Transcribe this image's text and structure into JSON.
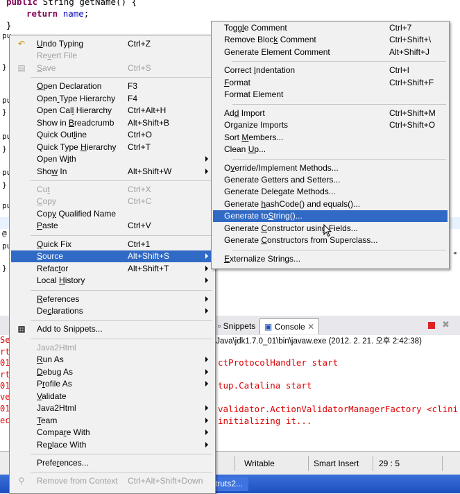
{
  "editor": {
    "line1": {
      "kw": "public",
      "rest": " String getName() {"
    },
    "line2": {
      "kw": "return",
      "field": "name",
      "end": ";"
    },
    "brace": "}",
    "gutter": [
      "pu",
      "}",
      "pu",
      "}",
      "pu",
      "}",
      "pu",
      "}",
      "pu",
      "}",
      "@",
      "pu",
      "}"
    ],
    "right_fragment": "\""
  },
  "views": {
    "tabs": [
      "Snippets",
      "Console"
    ],
    "console_title": "\\Java\\jdk1.7.0_01\\bin\\javaw.exe (2012. 2. 21. 오후 2:42:38)",
    "console_lines": [
      "ctProtocolHandler start",
      "tup.Catalina start",
      "validator.ActionValidatorManagerFactory <clini",
      "initializing it..."
    ],
    "left_strip": [
      "Se",
      "rt",
      "012",
      "rt",
      "012",
      "ve",
      "012",
      "ec"
    ]
  },
  "status": {
    "writable": "Writable",
    "insert": "Smart Insert",
    "position": "29 : 5"
  },
  "taskbar": {
    "item": "struts2..."
  },
  "context_menu": {
    "items": [
      {
        "label": "Undo Typing",
        "u": 0,
        "shortcut": "Ctrl+Z",
        "icon": "undo-icon"
      },
      {
        "label": "Revert File",
        "u": 2,
        "disabled": true
      },
      {
        "label": "Save",
        "u": 0,
        "shortcut": "Ctrl+S",
        "disabled": true,
        "icon": "save-icon"
      },
      {
        "sep": true
      },
      {
        "label": "Open Declaration",
        "u": 0,
        "shortcut": "F3"
      },
      {
        "label": "Open Type Hierarchy",
        "u": 4,
        "shortcut": "F4"
      },
      {
        "label": "Open Call Hierarchy",
        "u": 8,
        "shortcut": "Ctrl+Alt+H"
      },
      {
        "label": "Show in Breadcrumb",
        "u": 8,
        "shortcut": "Alt+Shift+B"
      },
      {
        "label": "Quick Outline",
        "u": 9,
        "shortcut": "Ctrl+O"
      },
      {
        "label": "Quick Type Hierarchy",
        "u": 11,
        "shortcut": "Ctrl+T"
      },
      {
        "label": "Open With",
        "u": 6,
        "submenu": true
      },
      {
        "label": "Show In",
        "u": 3,
        "shortcut": "Alt+Shift+W",
        "submenu": true
      },
      {
        "sep": true
      },
      {
        "label": "Cut",
        "u": 2,
        "shortcut": "Ctrl+X",
        "disabled": true
      },
      {
        "label": "Copy",
        "u": 0,
        "shortcut": "Ctrl+C",
        "disabled": true
      },
      {
        "label": "Copy Qualified Name",
        "u": 3
      },
      {
        "label": "Paste",
        "u": 0,
        "shortcut": "Ctrl+V"
      },
      {
        "sep": true
      },
      {
        "label": "Quick Fix",
        "u": 0,
        "shortcut": "Ctrl+1"
      },
      {
        "label": "Source",
        "u": 0,
        "shortcut": "Alt+Shift+S",
        "submenu": true,
        "highlighted": true
      },
      {
        "label": "Refactor",
        "u": 5,
        "shortcut": "Alt+Shift+T",
        "submenu": true
      },
      {
        "label": "Local History",
        "u": 6,
        "submenu": true
      },
      {
        "sep": true
      },
      {
        "label": "References",
        "u": 0,
        "submenu": true
      },
      {
        "label": "Declarations",
        "u": 2,
        "submenu": true
      },
      {
        "sep": true
      },
      {
        "label": "Add to Snippets...",
        "u": -1,
        "icon": "snippet-icon"
      },
      {
        "sep": true
      },
      {
        "label": "Java2Html",
        "u": -1,
        "disabled": true
      },
      {
        "label": "Run As",
        "u": 0,
        "submenu": true
      },
      {
        "label": "Debug As",
        "u": 0,
        "submenu": true
      },
      {
        "label": "Profile As",
        "u": 1,
        "submenu": true
      },
      {
        "label": "Validate",
        "u": 0
      },
      {
        "label": "Java2Html",
        "u": -1,
        "submenu": true
      },
      {
        "label": "Team",
        "u": 0,
        "submenu": true
      },
      {
        "label": "Compare With",
        "u": 5,
        "submenu": true
      },
      {
        "label": "Replace With",
        "u": 2,
        "submenu": true
      },
      {
        "sep": true
      },
      {
        "label": "Preferences...",
        "u": 5
      },
      {
        "sep": true
      },
      {
        "label": "Remove from Context",
        "u": -1,
        "shortcut": "Ctrl+Alt+Shift+Down",
        "disabled": true,
        "icon": "context-icon"
      }
    ]
  },
  "source_submenu": {
    "items": [
      {
        "label": "Toggle Comment",
        "u": 4,
        "shortcut": "Ctrl+7"
      },
      {
        "label": "Remove Block Comment",
        "u": 11,
        "shortcut": "Ctrl+Shift+\\"
      },
      {
        "label": "Generate Element Comment",
        "u": -1,
        "shortcut": "Alt+Shift+J"
      },
      {
        "sep": true
      },
      {
        "label": "Correct Indentation",
        "u": 8,
        "shortcut": "Ctrl+I"
      },
      {
        "label": "Format",
        "u": 0,
        "shortcut": "Ctrl+Shift+F"
      },
      {
        "label": "Format Element",
        "u": -1
      },
      {
        "sep": true
      },
      {
        "label": "Add Import",
        "u": 2,
        "shortcut": "Ctrl+Shift+M"
      },
      {
        "label": "Organize Imports",
        "u": 2,
        "shortcut": "Ctrl+Shift+O"
      },
      {
        "label": "Sort Members...",
        "u": 5
      },
      {
        "label": "Clean Up...",
        "u": 6
      },
      {
        "sep": true
      },
      {
        "label": "Override/Implement Methods...",
        "u": 1
      },
      {
        "label": "Generate Getters and Setters...",
        "u": -1
      },
      {
        "label": "Generate Delegate Methods...",
        "u": -1
      },
      {
        "label": "Generate hashCode() and equals()...",
        "u": 9
      },
      {
        "label": "Generate toString()...",
        "u": 11,
        "highlighted": true
      },
      {
        "label": "Generate Constructor using Fields...",
        "u": 9
      },
      {
        "label": "Generate Constructors from Superclass...",
        "u": 9
      },
      {
        "sep": true
      },
      {
        "label": "Externalize Strings...",
        "u": 0
      }
    ]
  }
}
